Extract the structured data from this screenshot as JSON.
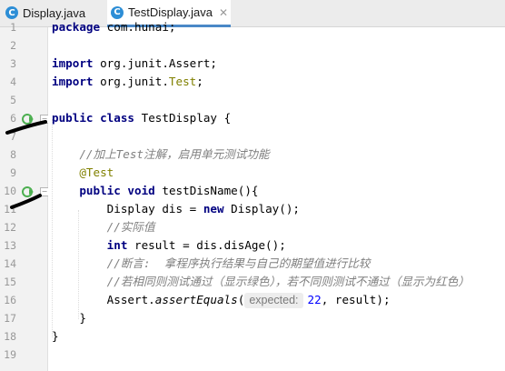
{
  "tabs": [
    {
      "label": "Display.java",
      "active": false
    },
    {
      "label": "TestDisplay.java",
      "active": true
    }
  ],
  "tab_icon_letter": "C",
  "lines": [
    {
      "num": "1",
      "parts": [
        [
          "kw",
          "package"
        ],
        [
          "",
          ""
        ],
        [
          "",
          "com.hunai;"
        ]
      ]
    },
    {
      "num": "2",
      "parts": []
    },
    {
      "num": "3",
      "parts": [
        [
          "kw",
          "import"
        ],
        [
          "",
          ""
        ],
        [
          "",
          "org.junit.Assert;"
        ]
      ]
    },
    {
      "num": "4",
      "parts": [
        [
          "kw",
          "import"
        ],
        [
          "",
          ""
        ],
        [
          "",
          "org.junit."
        ],
        [
          "an",
          "Test"
        ],
        [
          "",
          ";"
        ]
      ]
    },
    {
      "num": "5",
      "parts": []
    },
    {
      "num": "6",
      "parts": [
        [
          "kw",
          "public"
        ],
        [
          "kw",
          "class"
        ],
        [
          "",
          "TestDisplay {"
        ]
      ]
    },
    {
      "num": "7",
      "parts": []
    },
    {
      "num": "8",
      "parts": [
        [
          "cm",
          "    //加上Test注解，启用单元测试功能"
        ]
      ]
    },
    {
      "num": "9",
      "parts": [
        [
          "an",
          "    @Test"
        ]
      ]
    },
    {
      "num": "10",
      "parts": [
        [
          "kw",
          "    public"
        ],
        [
          "kw",
          "void"
        ],
        [
          "",
          "testDisName(){"
        ]
      ]
    },
    {
      "num": "11",
      "parts": [
        [
          "",
          "        Display dis = "
        ],
        [
          "kw",
          "new"
        ],
        [
          "",
          "Display();"
        ]
      ]
    },
    {
      "num": "12",
      "parts": [
        [
          "cm",
          "        //实际值"
        ]
      ]
    },
    {
      "num": "13",
      "parts": [
        [
          "kw",
          "        int"
        ],
        [
          "",
          "result = dis.disAge();"
        ]
      ]
    },
    {
      "num": "14",
      "parts": [
        [
          "cm",
          "        //断言:  拿程序执行结果与自己的期望值进行比较"
        ]
      ]
    },
    {
      "num": "15",
      "parts": [
        [
          "cm",
          "        //若相同则测试通过（显示绿色），若不同则测试不通过（显示为红色）"
        ]
      ]
    },
    {
      "num": "16",
      "parts": [
        [
          "",
          "        Assert."
        ],
        [
          "it",
          "assertEquals"
        ],
        [
          "",
          "("
        ],
        [
          "hint",
          "expected:"
        ],
        [
          "nm",
          "22"
        ],
        [
          "",
          ", result);"
        ]
      ]
    },
    {
      "num": "17",
      "parts": [
        [
          "",
          "    }"
        ]
      ]
    },
    {
      "num": "18",
      "parts": [
        [
          "",
          "}"
        ]
      ]
    },
    {
      "num": "19",
      "parts": []
    }
  ],
  "current_line": "16",
  "colors": {
    "keyword": "#000080",
    "comment": "#808080",
    "annotation": "#808000",
    "number": "#0000ff",
    "run_icon": "#4caf50",
    "tab_accent": "#4a88c7"
  }
}
